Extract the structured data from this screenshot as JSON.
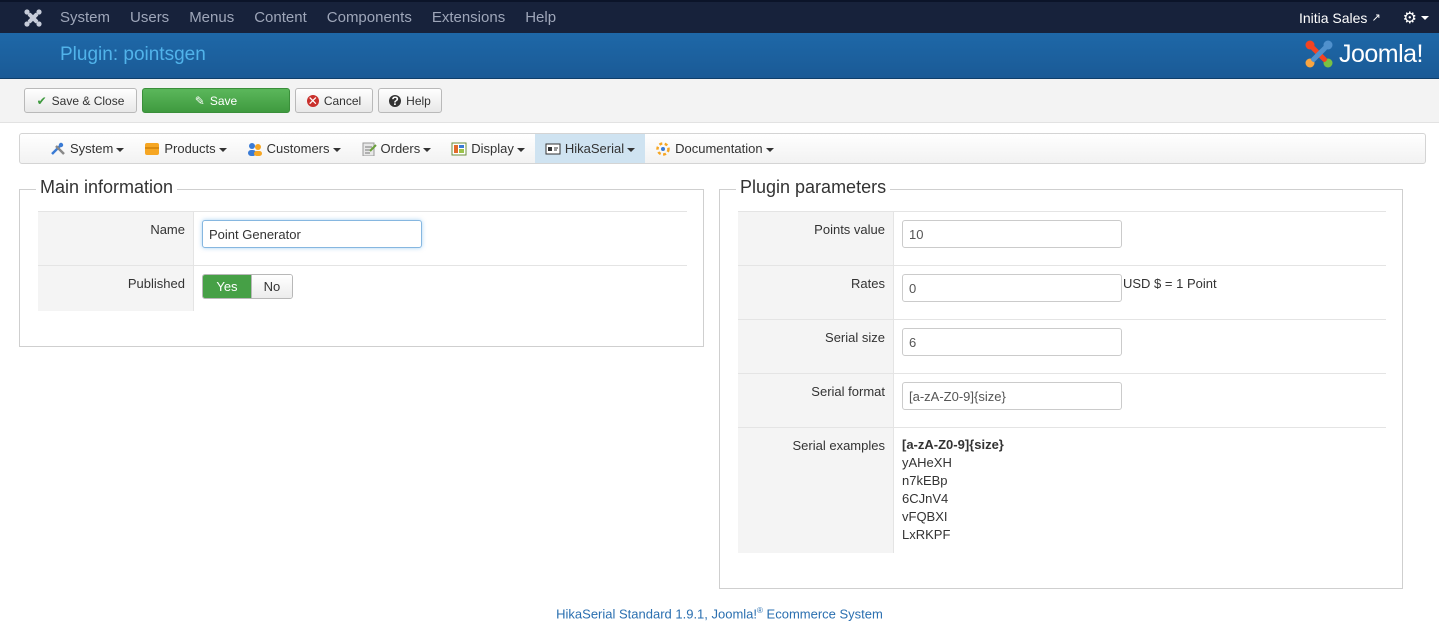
{
  "topbar": {
    "menu": [
      "System",
      "Users",
      "Menus",
      "Content",
      "Components",
      "Extensions",
      "Help"
    ],
    "site_name": "Initia Sales"
  },
  "header": {
    "title": "Plugin: pointsgen",
    "brand": "Joomla!"
  },
  "toolbar": {
    "save_close": "Save & Close",
    "save": "Save",
    "cancel": "Cancel",
    "help": "Help"
  },
  "submenu": {
    "items": [
      "System",
      "Products",
      "Customers",
      "Orders",
      "Display",
      "HikaSerial",
      "Documentation"
    ],
    "active": "HikaSerial"
  },
  "main_info": {
    "legend": "Main information",
    "name_label": "Name",
    "name_value": "Point Generator",
    "published_label": "Published",
    "yes": "Yes",
    "no": "No",
    "published_selected": "Yes"
  },
  "plugin_params": {
    "legend": "Plugin parameters",
    "points_label": "Points value",
    "points_value": "10",
    "rates_label": "Rates",
    "rates_value": "0",
    "rates_suffix": "USD $ = 1 Point",
    "serial_size_label": "Serial size",
    "serial_size_value": "6",
    "serial_format_label": "Serial format",
    "serial_format_value": "[a-zA-Z0-9]{size}",
    "serial_examples_label": "Serial examples",
    "examples": [
      "[a-zA-Z0-9]{size}",
      "yAHeXH",
      "n7kEBp",
      "6CJnV4",
      "vFQBXI",
      "LxRKPF"
    ]
  },
  "footer": {
    "prefix": "HikaSerial Standard 1.9.1, Joomla!",
    "reg": "®",
    "suffix": " Ecommerce System"
  },
  "colors": {
    "topbar": "#17223b",
    "header": "#1a5a96",
    "header_title": "#51b3ea",
    "save_green": "#46a046",
    "submenu_active": "#cfe3f1",
    "footer_link": "#2a6fb0"
  }
}
